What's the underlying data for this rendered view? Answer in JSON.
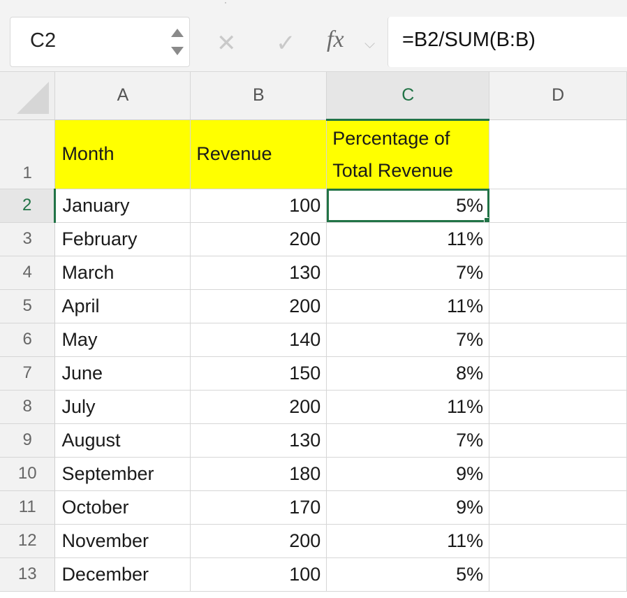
{
  "name_box": {
    "cell_reference": "C2"
  },
  "formula_bar": {
    "fx_label": "fx",
    "formula": "=B2/SUM(B:B)"
  },
  "column_headers": [
    "A",
    "B",
    "C",
    "D"
  ],
  "active_cell": {
    "column": "C",
    "row": 2
  },
  "header_row": {
    "row_number": "1",
    "month": "Month",
    "revenue": "Revenue",
    "percentage": "Percentage of Total Revenue"
  },
  "rows": [
    {
      "row_number": "2",
      "month": "January",
      "revenue": "100",
      "percentage": "5%"
    },
    {
      "row_number": "3",
      "month": "February",
      "revenue": "200",
      "percentage": "11%"
    },
    {
      "row_number": "4",
      "month": "March",
      "revenue": "130",
      "percentage": "7%"
    },
    {
      "row_number": "5",
      "month": "April",
      "revenue": "200",
      "percentage": "11%"
    },
    {
      "row_number": "6",
      "month": "May",
      "revenue": "140",
      "percentage": "7%"
    },
    {
      "row_number": "7",
      "month": "June",
      "revenue": "150",
      "percentage": "8%"
    },
    {
      "row_number": "8",
      "month": "July",
      "revenue": "200",
      "percentage": "11%"
    },
    {
      "row_number": "9",
      "month": "August",
      "revenue": "130",
      "percentage": "7%"
    },
    {
      "row_number": "10",
      "month": "September",
      "revenue": "180",
      "percentage": "9%"
    },
    {
      "row_number": "11",
      "month": "October",
      "revenue": "170",
      "percentage": "9%"
    },
    {
      "row_number": "12",
      "month": "November",
      "revenue": "200",
      "percentage": "11%"
    },
    {
      "row_number": "13",
      "month": "December",
      "revenue": "100",
      "percentage": "5%"
    }
  ],
  "colors": {
    "header_fill": "#ffff00",
    "selection": "#217346"
  }
}
